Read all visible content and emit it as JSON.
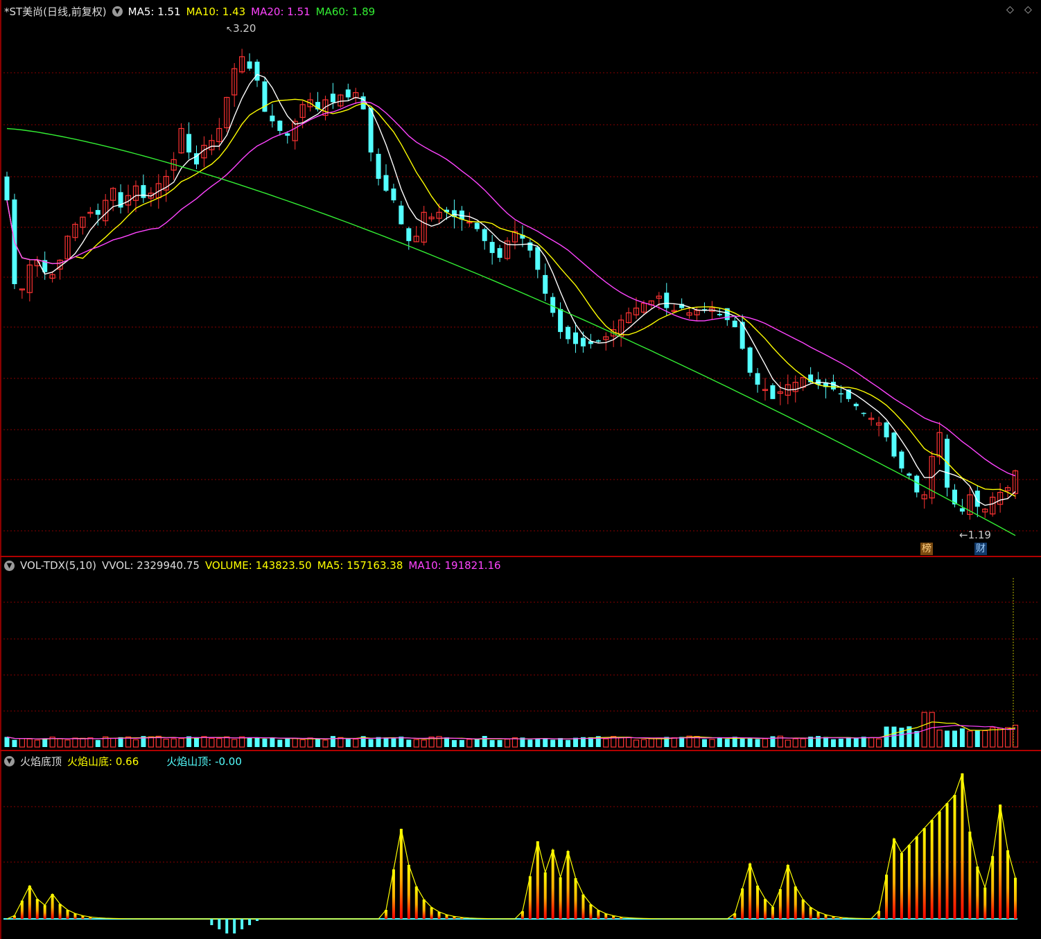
{
  "price_panel": {
    "stock_name": "*ST美尚(日线,前复权)",
    "indicators": [
      {
        "label": "MA5: 1.51",
        "color": "#ffffff"
      },
      {
        "label": "MA10: 1.43",
        "color": "#ffff00"
      },
      {
        "label": "MA20: 1.51",
        "color": "#ff44ff"
      },
      {
        "label": "MA60: 1.89",
        "color": "#33ee33"
      }
    ],
    "high_label": "3.20",
    "low_label": "1.19",
    "markers": [
      "榜",
      "财"
    ]
  },
  "volume_panel": {
    "title": "VOL-TDX(5,10)",
    "vvol": "VVOL: 2329940.75",
    "volume": "VOLUME: 143823.50",
    "ma5": "MA5: 157163.38",
    "ma10": "MA10: 191821.16"
  },
  "flame_panel": {
    "title": "火焰底顶",
    "bottom": "火焰山底: 0.66",
    "top": "火焰山顶: -0.00"
  },
  "colors": {
    "up": "#ff3333",
    "down": "#54ffff",
    "ma5": "#ffffff",
    "ma10": "#ffff00",
    "ma20": "#ff44ff",
    "ma60": "#33ee33",
    "grid": "#8a0000",
    "separator": "#b00000"
  },
  "chart_data": {
    "type": "candlestick",
    "ylim": [
      1.1,
      3.3
    ],
    "closes": [
      2.55,
      2.2,
      2.18,
      2.28,
      2.3,
      2.25,
      2.24,
      2.3,
      2.4,
      2.45,
      2.48,
      2.5,
      2.49,
      2.55,
      2.6,
      2.52,
      2.57,
      2.61,
      2.56,
      2.58,
      2.62,
      2.65,
      2.72,
      2.85,
      2.75,
      2.7,
      2.78,
      2.8,
      2.85,
      2.98,
      3.1,
      3.15,
      3.1,
      3.05,
      2.92,
      2.88,
      2.84,
      2.82,
      2.88,
      2.95,
      2.97,
      2.93,
      2.97,
      2.96,
      2.99,
      2.98,
      3.0,
      2.93,
      2.75,
      2.64,
      2.59,
      2.55,
      2.45,
      2.38,
      2.4,
      2.5,
      2.48,
      2.5,
      2.5,
      2.48,
      2.47,
      2.46,
      2.43,
      2.38,
      2.33,
      2.31,
      2.38,
      2.42,
      2.39,
      2.34,
      2.26,
      2.16,
      2.08,
      2.0,
      1.97,
      1.95,
      1.94,
      1.95,
      1.96,
      1.98,
      2.01,
      2.05,
      2.08,
      2.1,
      2.12,
      2.13,
      2.15,
      2.1,
      2.09,
      2.1,
      2.08,
      2.09,
      2.09,
      2.1,
      2.07,
      2.05,
      2.02,
      1.93,
      1.83,
      1.78,
      1.76,
      1.72,
      1.75,
      1.78,
      1.79,
      1.81,
      1.79,
      1.78,
      1.77,
      1.76,
      1.74,
      1.72,
      1.69,
      1.66,
      1.64,
      1.62,
      1.56,
      1.48,
      1.43,
      1.4,
      1.33,
      1.32,
      1.48,
      1.58,
      1.35,
      1.28,
      1.25,
      1.32,
      1.27,
      1.26,
      1.31,
      1.33,
      1.35,
      1.42
    ]
  }
}
